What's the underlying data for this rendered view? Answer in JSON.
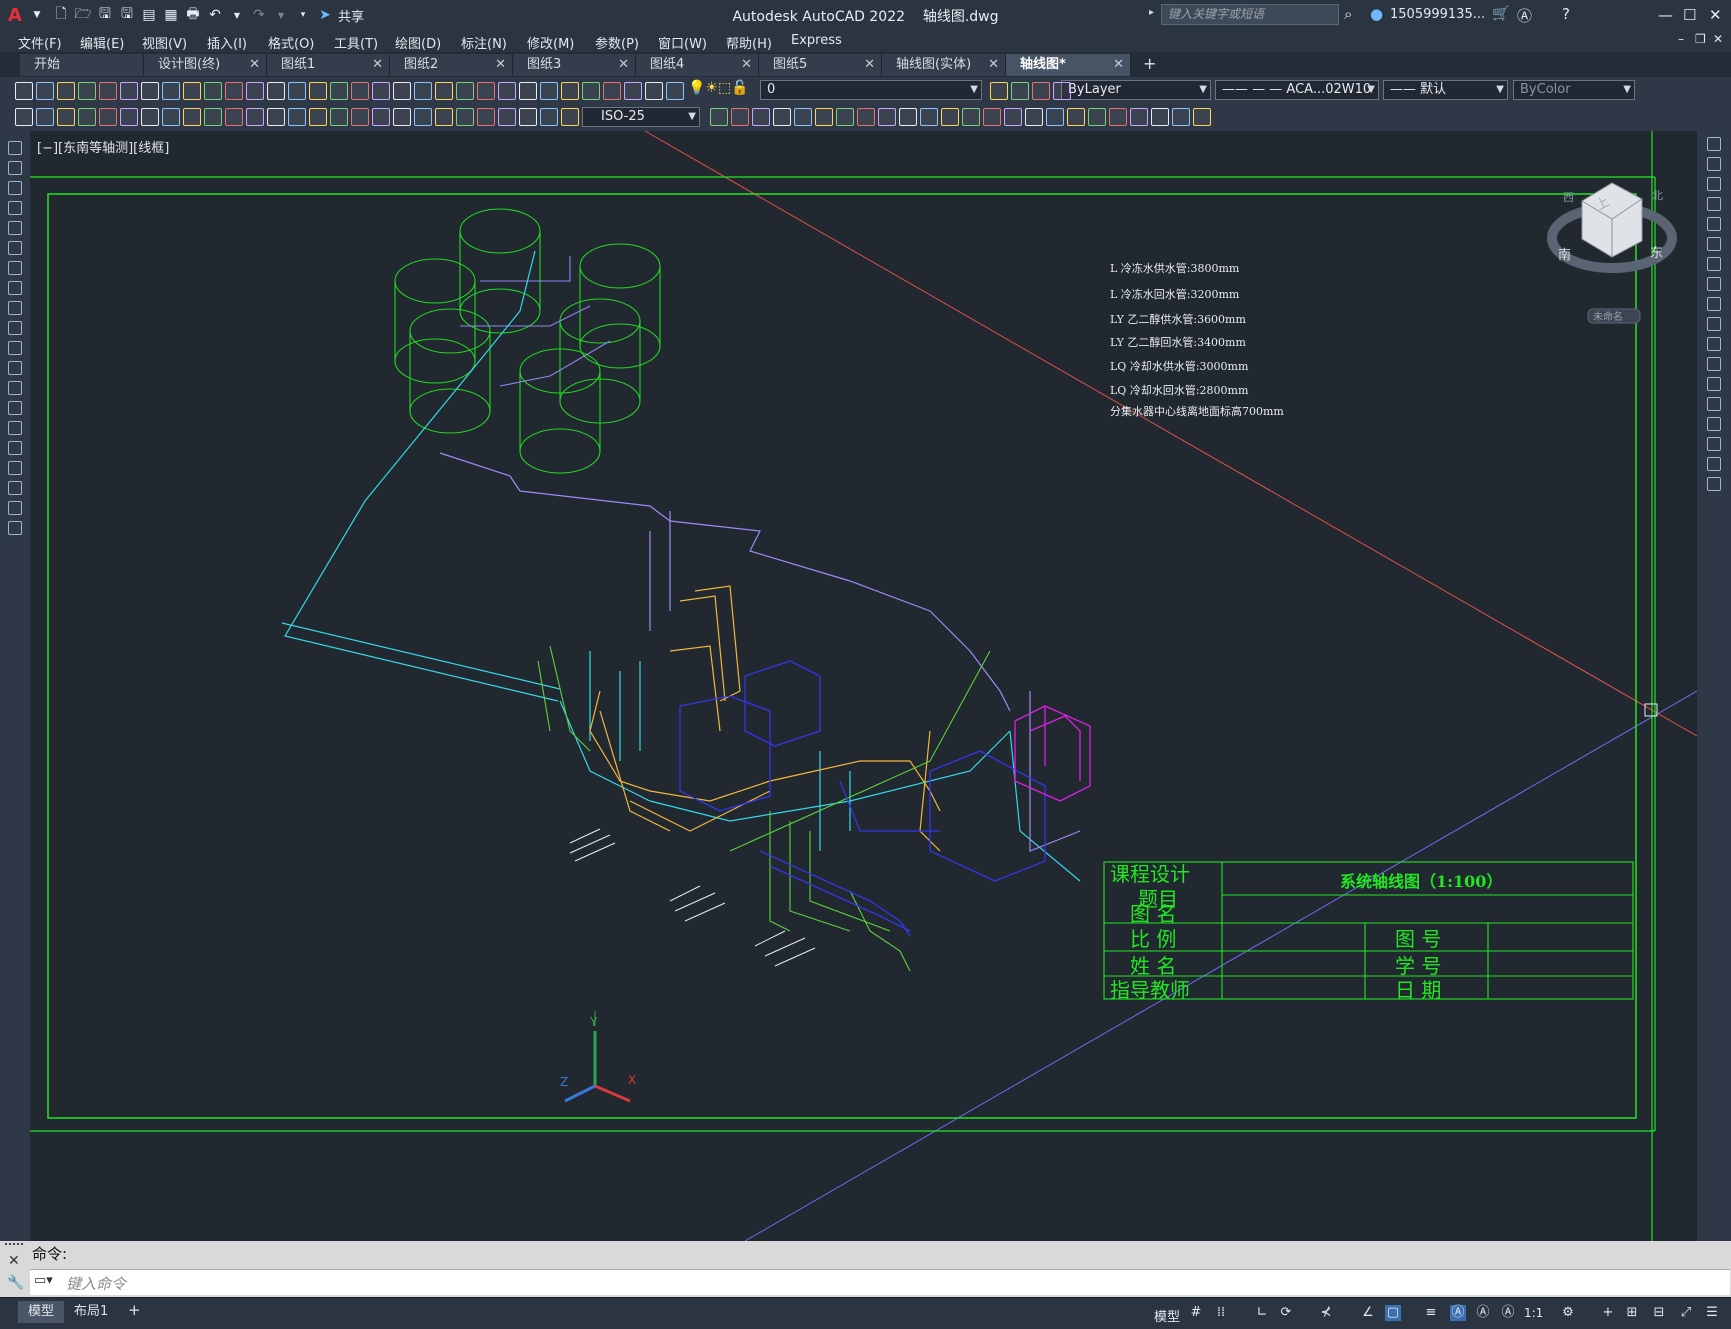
{
  "app": {
    "logo": "A",
    "title": "Autodesk AutoCAD 2022",
    "filename": "轴线图.dwg",
    "share_label": "共享",
    "search_placeholder": "键入关键字或短语",
    "user": "1505999135...",
    "icons": [
      "new-icon",
      "open-icon",
      "save-icon",
      "saveas-icon",
      "publish-icon",
      "plot-icon",
      "undo-icon",
      "redo-icon"
    ]
  },
  "menu": [
    "文件(F)",
    "编辑(E)",
    "视图(V)",
    "插入(I)",
    "格式(O)",
    "工具(T)",
    "绘图(D)",
    "标注(N)",
    "修改(M)",
    "参数(P)",
    "窗口(W)",
    "帮助(H)",
    "Express"
  ],
  "tabs": [
    {
      "label": "开始",
      "closable": false
    },
    {
      "label": "设计图(终)",
      "closable": true
    },
    {
      "label": "图纸1",
      "closable": true
    },
    {
      "label": "图纸2",
      "closable": true
    },
    {
      "label": "图纸3",
      "closable": true
    },
    {
      "label": "图纸4",
      "closable": true
    },
    {
      "label": "图纸5",
      "closable": true
    },
    {
      "label": "轴线图(实体)",
      "closable": true
    },
    {
      "label": "轴线图*",
      "closable": true,
      "active": true
    }
  ],
  "add_tab": "+",
  "toolbar": {
    "layer": "0",
    "color": "ByLayer",
    "linetype": "ACA...02W10",
    "lineweight": "默认",
    "plotstyle": "ByColor",
    "dimstyle": "ISO-25"
  },
  "viewport": {
    "label": "[−][东南等轴测][线框]",
    "viewcube": {
      "top": "上",
      "south": "南",
      "east": "东",
      "west": "西",
      "north": "北",
      "wcs": "未命名"
    }
  },
  "drawing": {
    "legend": [
      "L  冷冻水供水管:3800mm",
      "L  冷冻水回水管:3200mm",
      "LY 乙二醇供水管:3600mm",
      "LY 乙二醇回水管:3400mm",
      "LQ 冷却水供水管:3000mm",
      "LQ 冷却水回水管:2800mm",
      "分集水器中心线离地面标高700mm"
    ],
    "title_block": {
      "course": "课程设计",
      "topic_label": "题目",
      "title": "系统轴线图（1:100）",
      "name_label": "图  名",
      "scale_label": "比  例",
      "drawing_no_label": "图  号",
      "student_name_label": "姓  名",
      "student_no_label": "学  号",
      "teacher_label": "指导教师",
      "date_label": "日  期"
    }
  },
  "command": {
    "history": "命令:",
    "placeholder": "键入命令"
  },
  "layout_tabs": [
    {
      "label": "模型",
      "active": true
    },
    {
      "label": "布局1",
      "active": false
    }
  ],
  "status": {
    "model": "模型",
    "scale": "1:1"
  },
  "colors": {
    "canvas": "#212830",
    "frame_green": "#22e622",
    "pipe_cyan": "#34d8e6",
    "pipe_violet": "#9b8cf5",
    "pipe_orange": "#f2b83c",
    "pipe_blue": "#3236e8",
    "equipment_magenta": "#e11fe6"
  }
}
